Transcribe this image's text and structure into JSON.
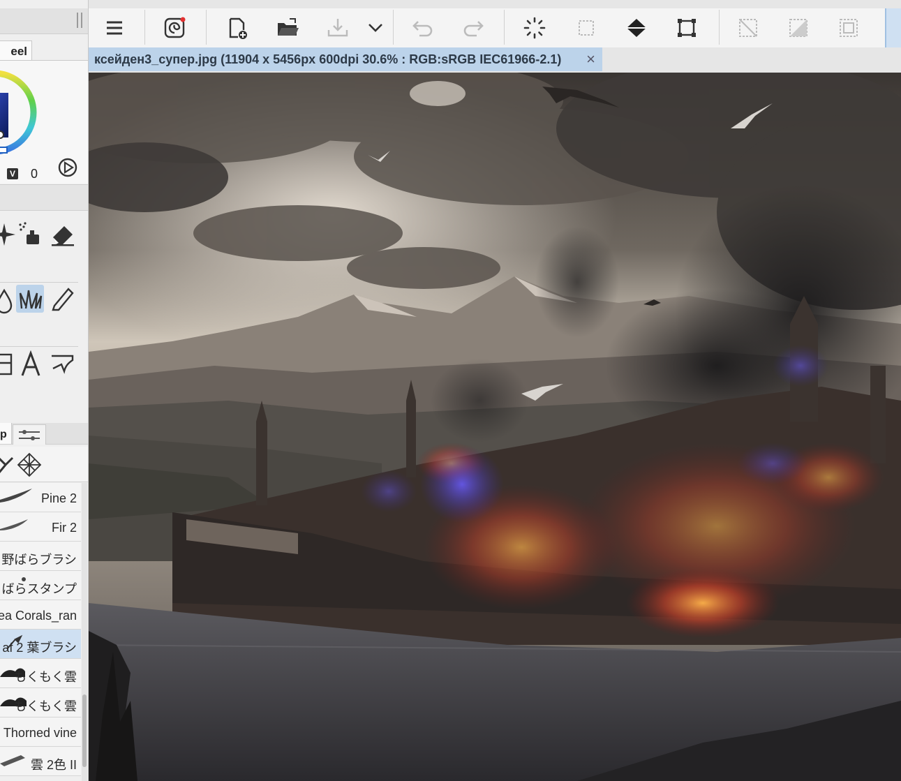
{
  "left_panel": {
    "color_tab_label": "eel",
    "hsv_value_badge": "V",
    "hsv_value": "0",
    "brush_tab_label": "p",
    "brushes": [
      {
        "label": "Pine 2",
        "selected": false
      },
      {
        "label": "Fir 2",
        "selected": false
      },
      {
        "label": "野ばらブラシ",
        "selected": false
      },
      {
        "label": "ばらスタンプ",
        "selected": false
      },
      {
        "label": "ea Corals_ran",
        "selected": false
      },
      {
        "label": "af 2  葉ブラシ",
        "selected": true
      },
      {
        "label": "もくもく雲",
        "selected": false
      },
      {
        "label": "もくもく雲",
        "selected": false
      },
      {
        "label": "Thorned vine",
        "selected": false
      },
      {
        "label": "雲  2色  II",
        "selected": false
      }
    ],
    "tools": [
      "sparkle-icon",
      "spray-icon",
      "eraser-icon",
      "drop-icon",
      "grass-brush-icon",
      "pencil-icon",
      "frame-icon",
      "text-tool-icon",
      "balloon-icon"
    ],
    "selected_tool": "grass-brush-icon"
  },
  "toolbar": {
    "buttons": [
      "menu-icon",
      "companion-icon",
      "new-file-icon",
      "open-folder-icon",
      "save-icon",
      "dropdown-chevron-icon",
      "undo-icon",
      "redo-icon",
      "loading-icon",
      "selection-icon",
      "fill-icon",
      "transform-icon",
      "deselect-icon",
      "invert-selection-icon",
      "selection-border-icon"
    ]
  },
  "document": {
    "title": "ксейден3_супер.jpg (11904 x 5456px 600dpi 30.6% : RGB:sRGB IEC61966-2.1)",
    "close_glyph": "×"
  },
  "colors": {
    "accent": "#bcd3ea",
    "selected_brush": "#cfe0f2",
    "panel_bg": "#efefef"
  }
}
